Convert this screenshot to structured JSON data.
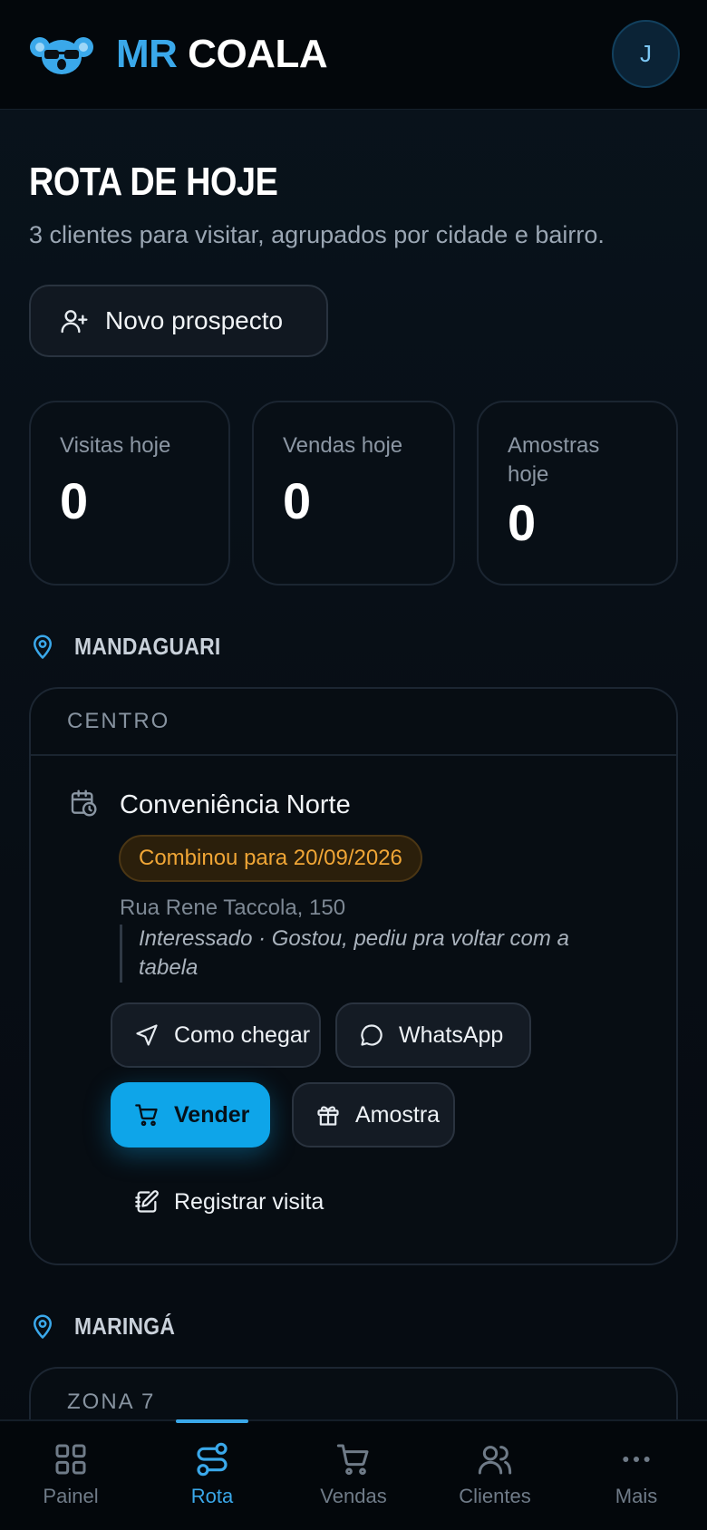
{
  "header": {
    "brand_part1": "MR",
    "brand_part2": "COALA",
    "avatar_initial": "J"
  },
  "page": {
    "title": "ROTA DE HOJE",
    "subtitle": "3 clientes para visitar, agrupados por cidade e bairro.",
    "new_prospect_label": "Novo prospecto"
  },
  "stats": [
    {
      "label": "Visitas hoje",
      "value": "0"
    },
    {
      "label": "Vendas hoje",
      "value": "0"
    },
    {
      "label": "Amostras hoje",
      "value": "0"
    }
  ],
  "groups": [
    {
      "city": "MANDAGUARI",
      "neighborhood": "CENTRO",
      "client": {
        "name": "Conveniência Norte",
        "badge": "Combinou para 20/09/2026",
        "address": "Rua Rene Taccola, 150",
        "note": "Interessado · Gostou, pediu pra voltar com a tabela"
      },
      "actions": {
        "directions": "Como chegar",
        "whatsapp": "WhatsApp",
        "sell": "Vender",
        "sample": "Amostra",
        "register_visit": "Registrar visita"
      }
    },
    {
      "city": "MARINGÁ",
      "neighborhood": "ZONA 7"
    }
  ],
  "nav": [
    {
      "label": "Painel",
      "icon": "grid-icon"
    },
    {
      "label": "Rota",
      "icon": "route-icon",
      "active": true
    },
    {
      "label": "Vendas",
      "icon": "cart-icon"
    },
    {
      "label": "Clientes",
      "icon": "users-icon"
    },
    {
      "label": "Mais",
      "icon": "more-icon"
    }
  ],
  "colors": {
    "accent": "#0ea5e9",
    "brand_blue": "#3aa8ea",
    "badge_text": "#f0a636",
    "background": "#060c12"
  }
}
